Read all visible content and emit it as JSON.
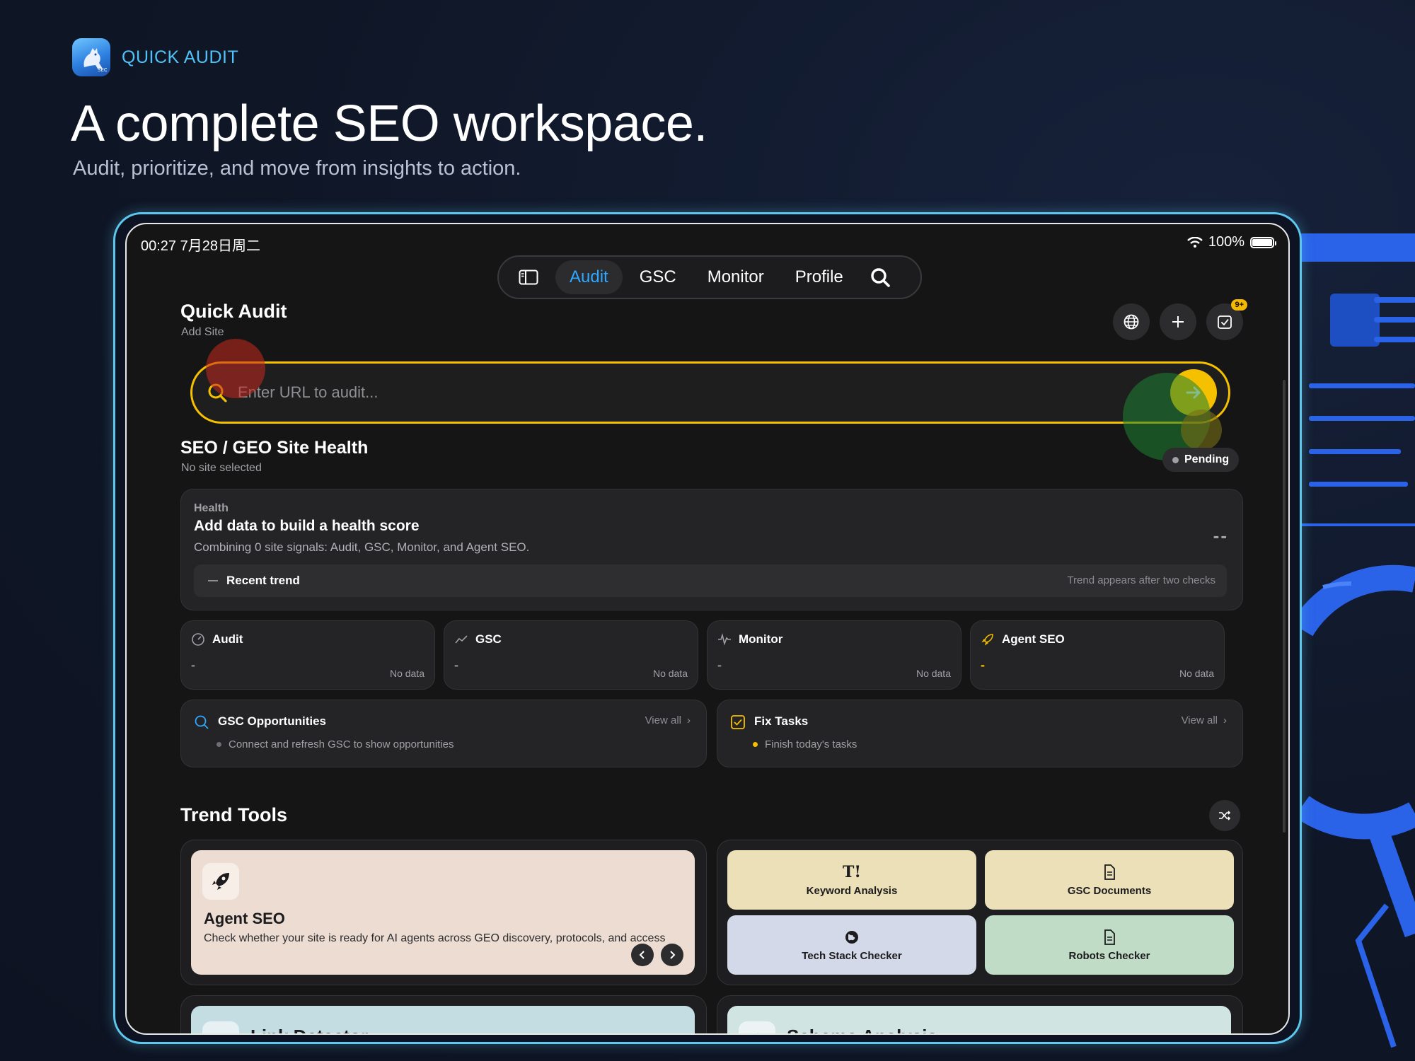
{
  "brand": {
    "name": "QUICK AUDIT",
    "icon": "kangaroo-app-icon"
  },
  "headline": "A complete SEO workspace.",
  "subline": "Audit, prioritize, and move from insights to action.",
  "status_bar": {
    "time": "00:27  7月28日周二",
    "battery": "100%"
  },
  "nav": {
    "tabs": [
      {
        "label": "Audit",
        "active": true
      },
      {
        "label": "GSC",
        "active": false
      },
      {
        "label": "Monitor",
        "active": false
      },
      {
        "label": "Profile",
        "active": false
      }
    ]
  },
  "quick_audit": {
    "title": "Quick Audit",
    "subtitle": "Add Site",
    "placeholder": "Enter URL to audit...",
    "tasks_badge": "9+"
  },
  "site_health": {
    "title": "SEO / GEO Site Health",
    "subtitle": "No site selected",
    "status": "Pending",
    "card": {
      "label": "Health",
      "title": "Add data to build a health score",
      "description": "Combining 0 site signals: Audit, GSC, Monitor, and Agent SEO.",
      "score": "--",
      "trend_label": "Recent trend",
      "trend_note": "Trend appears after two checks"
    }
  },
  "metrics": [
    {
      "title": "Audit",
      "icon": "gauge-icon",
      "value": "-",
      "note": "No data"
    },
    {
      "title": "GSC",
      "icon": "trend-line-icon",
      "value": "-",
      "note": "No data"
    },
    {
      "title": "Monitor",
      "icon": "pulse-icon",
      "value": "-",
      "note": "No data"
    },
    {
      "title": "Agent SEO",
      "icon": "rocket-icon",
      "value": "-",
      "note": "No data"
    }
  ],
  "opportunities": {
    "title": "GSC Opportunities",
    "view_all": "View all",
    "item": "Connect and refresh GSC to show opportunities"
  },
  "fix_tasks": {
    "title": "Fix Tasks",
    "view_all": "View all",
    "item": "Finish today's tasks"
  },
  "trend_tools": {
    "title": "Trend Tools",
    "featured": {
      "title": "Agent SEO",
      "description": "Check whether your site is ready for AI agents across GEO discovery, protocols, and access"
    },
    "tiles": [
      {
        "label": "Keyword Analysis",
        "icon": "T!",
        "color": "#ebe0b7"
      },
      {
        "label": "GSC Documents",
        "icon": "document-icon",
        "color": "#ebe0b7"
      },
      {
        "label": "Tech Stack Checker",
        "icon": "globe-icon",
        "color": "#d3d9e8"
      },
      {
        "label": "Robots Checker",
        "icon": "document-icon",
        "color": "#c1dcc6"
      }
    ],
    "bottom": [
      {
        "title": "Link Detector",
        "color": "#c3dde2"
      },
      {
        "title": "Schema Analysis",
        "color": "#d0e4e2"
      }
    ]
  },
  "colors": {
    "accent": "#2fa8ff",
    "gold": "#f5c000",
    "brand": "#4fc3f7"
  }
}
